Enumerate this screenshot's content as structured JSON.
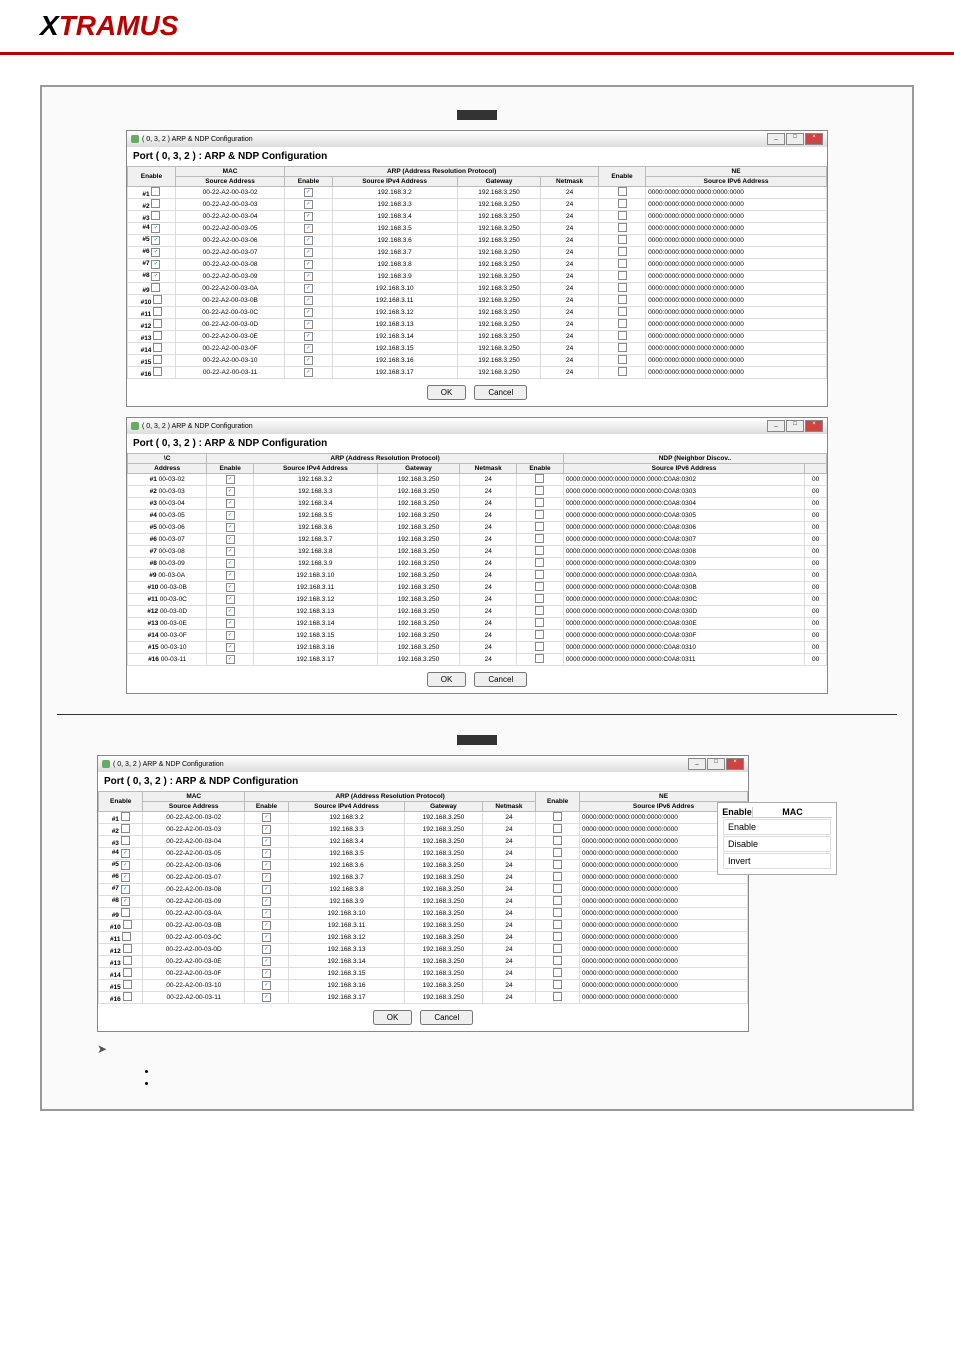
{
  "logo": {
    "pre": "X",
    "rest": "TRAMUS"
  },
  "wt": "( 0, 3, 2 ) ARP & NDP Configuration",
  "heading": "Port ( 0, 3, 2 ) : ARP & NDP Configuration",
  "hdr": {
    "mac": "MAC",
    "macAddr": "Address",
    "srcAddr": "Source Address",
    "arp": "ARP (Address Resolution Protocol)",
    "ndp": "NDP (Neighbor Discov..",
    "ne": "NE",
    "en": "Enable",
    "sip": "Source IPv4 Address",
    "gw": "Gateway",
    "nm": "Netmask",
    "sip6": "Source IPv6 Address",
    "sip6a": "Source IPv6 Addres"
  },
  "btn": {
    "ok": "OK",
    "cancel": "Cancel"
  },
  "ctx": {
    "title": "MAC",
    "enable": "Enable",
    "disable": "Disable",
    "invert": "Invert",
    "en": "Enable"
  },
  "rows": [
    {
      "n": "#1",
      "m": "00-22-A2-00-03-02",
      "ms": "00-03-02",
      "s": "192.168.3.2",
      "g": "192.168.3.250",
      "k": "24",
      "v6": "0000:0000:0000:0000:0000:0000",
      "v6f": "0000:0000:0000:0000:0000:0000:C0A8:0302",
      "d": "00"
    },
    {
      "n": "#2",
      "m": "00-22-A2-00-03-03",
      "ms": "00-03-03",
      "s": "192.168.3.3",
      "g": "192.168.3.250",
      "k": "24",
      "v6": "0000:0000:0000:0000:0000:0000",
      "v6f": "0000:0000:0000:0000:0000:0000:C0A8:0303",
      "d": "00"
    },
    {
      "n": "#3",
      "m": "00-22-A2-00-03-04",
      "ms": "00-03-04",
      "s": "192.168.3.4",
      "g": "192.168.3.250",
      "k": "24",
      "v6": "0000:0000:0000:0000:0000:0000",
      "v6f": "0000:0000:0000:0000:0000:0000:C0A8:0304",
      "d": "00"
    },
    {
      "n": "#4",
      "m": "00-22-A2-00-03-05",
      "ms": "00-03-05",
      "s": "192.168.3.5",
      "g": "192.168.3.250",
      "k": "24",
      "v6": "0000:0000:0000:0000:0000:0000",
      "v6f": "0000:0000:0000:0000:0000:0000:C0A8:0305",
      "d": "00",
      "e1": true
    },
    {
      "n": "#5",
      "m": "00-22-A2-00-03-06",
      "ms": "00-03-06",
      "s": "192.168.3.6",
      "g": "192.168.3.250",
      "k": "24",
      "v6": "0000:0000:0000:0000:0000:0000",
      "v6f": "0000:0000:0000:0000:0000:0000:C0A8:0306",
      "d": "00",
      "e1": true
    },
    {
      "n": "#6",
      "m": "00-22-A2-00-03-07",
      "ms": "00-03-07",
      "s": "192.168.3.7",
      "g": "192.168.3.250",
      "k": "24",
      "v6": "0000:0000:0000:0000:0000:0000",
      "v6f": "0000:0000:0000:0000:0000:0000:C0A8:0307",
      "d": "00",
      "e1": true
    },
    {
      "n": "#7",
      "m": "00-22-A2-00-03-08",
      "ms": "00-03-08",
      "s": "192.168.3.8",
      "g": "192.168.3.250",
      "k": "24",
      "v6": "0000:0000:0000:0000:0000:0000",
      "v6f": "0000:0000:0000:0000:0000:0000:C0A8:0308",
      "d": "00",
      "e1": true
    },
    {
      "n": "#8",
      "m": "00-22-A2-00-03-09",
      "ms": "00-03-09",
      "s": "192.168.3.9",
      "g": "192.168.3.250",
      "k": "24",
      "v6": "0000:0000:0000:0000:0000:0000",
      "v6f": "0000:0000:0000:0000:0000:0000:C0A8:0309",
      "d": "00",
      "e1": true
    },
    {
      "n": "#9",
      "m": "00-22-A2-00-03-0A",
      "ms": "00-03-0A",
      "s": "192.168.3.10",
      "g": "192.168.3.250",
      "k": "24",
      "v6": "0000:0000:0000:0000:0000:0000",
      "v6f": "0000:0000:0000:0000:0000:0000:C0A8:030A",
      "d": "00"
    },
    {
      "n": "#10",
      "m": "00-22-A2-00-03-0B",
      "ms": "00-03-0B",
      "s": "192.168.3.11",
      "g": "192.168.3.250",
      "k": "24",
      "v6": "0000:0000:0000:0000:0000:0000",
      "v6f": "0000:0000:0000:0000:0000:0000:C0A8:030B",
      "d": "00"
    },
    {
      "n": "#11",
      "m": "00-22-A2-00-03-0C",
      "ms": "00-03-0C",
      "s": "192.168.3.12",
      "g": "192.168.3.250",
      "k": "24",
      "v6": "0000:0000:0000:0000:0000:0000",
      "v6f": "0000:0000:0000:0000:0000:0000:C0A8:030C",
      "d": "00"
    },
    {
      "n": "#12",
      "m": "00-22-A2-00-03-0D",
      "ms": "00-03-0D",
      "s": "192.168.3.13",
      "g": "192.168.3.250",
      "k": "24",
      "v6": "0000:0000:0000:0000:0000:0000",
      "v6f": "0000:0000:0000:0000:0000:0000:C0A8:030D",
      "d": "00"
    },
    {
      "n": "#13",
      "m": "00-22-A2-00-03-0E",
      "ms": "00-03-0E",
      "s": "192.168.3.14",
      "g": "192.168.3.250",
      "k": "24",
      "v6": "0000:0000:0000:0000:0000:0000",
      "v6f": "0000:0000:0000:0000:0000:0000:C0A8:030E",
      "d": "00"
    },
    {
      "n": "#14",
      "m": "00-22-A2-00-03-0F",
      "ms": "00-03-0F",
      "s": "192.168.3.15",
      "g": "192.168.3.250",
      "k": "24",
      "v6": "0000:0000:0000:0000:0000:0000",
      "v6f": "0000:0000:0000:0000:0000:0000:C0A8:030F",
      "d": "00"
    },
    {
      "n": "#15",
      "m": "00-22-A2-00-03-10",
      "ms": "00-03-10",
      "s": "192.168.3.16",
      "g": "192.168.3.250",
      "k": "24",
      "v6": "0000:0000:0000:0000:0000:0000",
      "v6f": "0000:0000:0000:0000:0000:0000:C0A8:0310",
      "d": "00"
    },
    {
      "n": "#16",
      "m": "00-22-A2-00-03-11",
      "ms": "00-03-11",
      "s": "192.168.3.17",
      "g": "192.168.3.250",
      "k": "24",
      "v6": "0000:0000:0000:0000:0000:0000",
      "v6f": "0000:0000:0000:0000:0000:0000:C0A8:0311",
      "d": "00"
    }
  ]
}
